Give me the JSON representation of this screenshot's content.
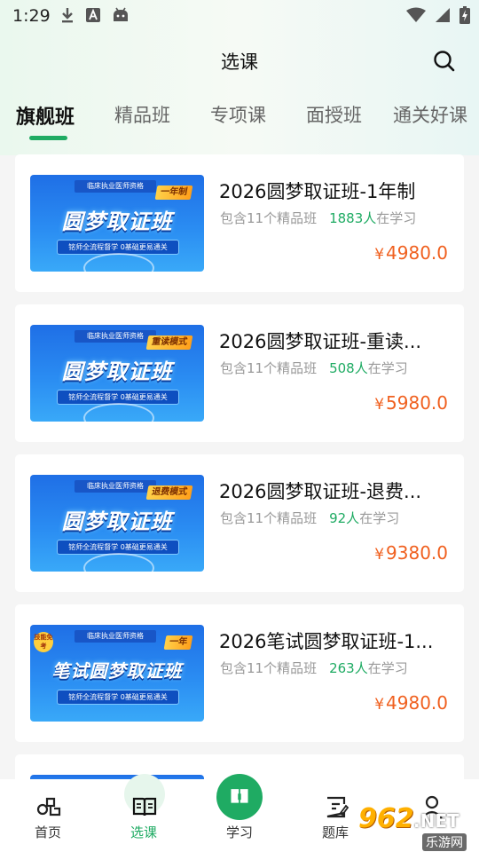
{
  "status_bar": {
    "time": "1:29"
  },
  "header": {
    "title": "选课"
  },
  "tabs": [
    {
      "label": "旗舰班",
      "active": true
    },
    {
      "label": "精品班",
      "active": false
    },
    {
      "label": "专项课",
      "active": false
    },
    {
      "label": "面授班",
      "active": false
    },
    {
      "label": "通关好课",
      "active": false
    }
  ],
  "courses": [
    {
      "title": "2026圆梦取证班-1年制",
      "includes": "包含11个精品班",
      "learners": "1883人",
      "learners_suffix": "在学习",
      "currency": "¥",
      "price": "4980.0",
      "thumb": {
        "header": "临床执业医师资格",
        "badge": "一年制",
        "main": "圆梦取证班",
        "slogan": "铭师全流程督学 0基础更易通关"
      }
    },
    {
      "title": "2026圆梦取证班-重读...",
      "includes": "包含11个精品班",
      "learners": "508人",
      "learners_suffix": "在学习",
      "currency": "¥",
      "price": "5980.0",
      "thumb": {
        "header": "临床执业医师资格",
        "badge": "重读模式",
        "main": "圆梦取证班",
        "slogan": "铭师全流程督学 0基础更易通关"
      }
    },
    {
      "title": "2026圆梦取证班-退费...",
      "includes": "包含11个精品班",
      "learners": "92人",
      "learners_suffix": "在学习",
      "currency": "¥",
      "price": "9380.0",
      "thumb": {
        "header": "临床执业医师资格",
        "badge": "退费模式",
        "main": "圆梦取证班",
        "slogan": "铭师全流程督学 0基础更易通关"
      }
    },
    {
      "title": "2026笔试圆梦取证班-1...",
      "includes": "包含11个精品班",
      "learners": "263人",
      "learners_suffix": "在学习",
      "currency": "¥",
      "price": "4980.0",
      "thumb": {
        "header": "临床执业医师资格",
        "badge": "一年",
        "main": "笔试圆梦取证班",
        "slogan": "铭师全流程督学 0基础更易通关",
        "tag": "技能免考"
      }
    }
  ],
  "bottom_nav": [
    {
      "label": "首页",
      "icon": "home-icon",
      "active": false
    },
    {
      "label": "选课",
      "icon": "book-icon",
      "active": true
    },
    {
      "label": "学习",
      "icon": "study-icon",
      "active": false
    },
    {
      "label": "题库",
      "icon": "question-bank-icon",
      "active": false
    },
    {
      "label": "",
      "icon": "profile-icon",
      "active": false
    }
  ],
  "watermark": {
    "number": "962",
    "domain": ".NET",
    "site": "乐游网"
  },
  "colors": {
    "accent": "#1fab63",
    "price": "#f0601f",
    "muted": "#999999"
  }
}
